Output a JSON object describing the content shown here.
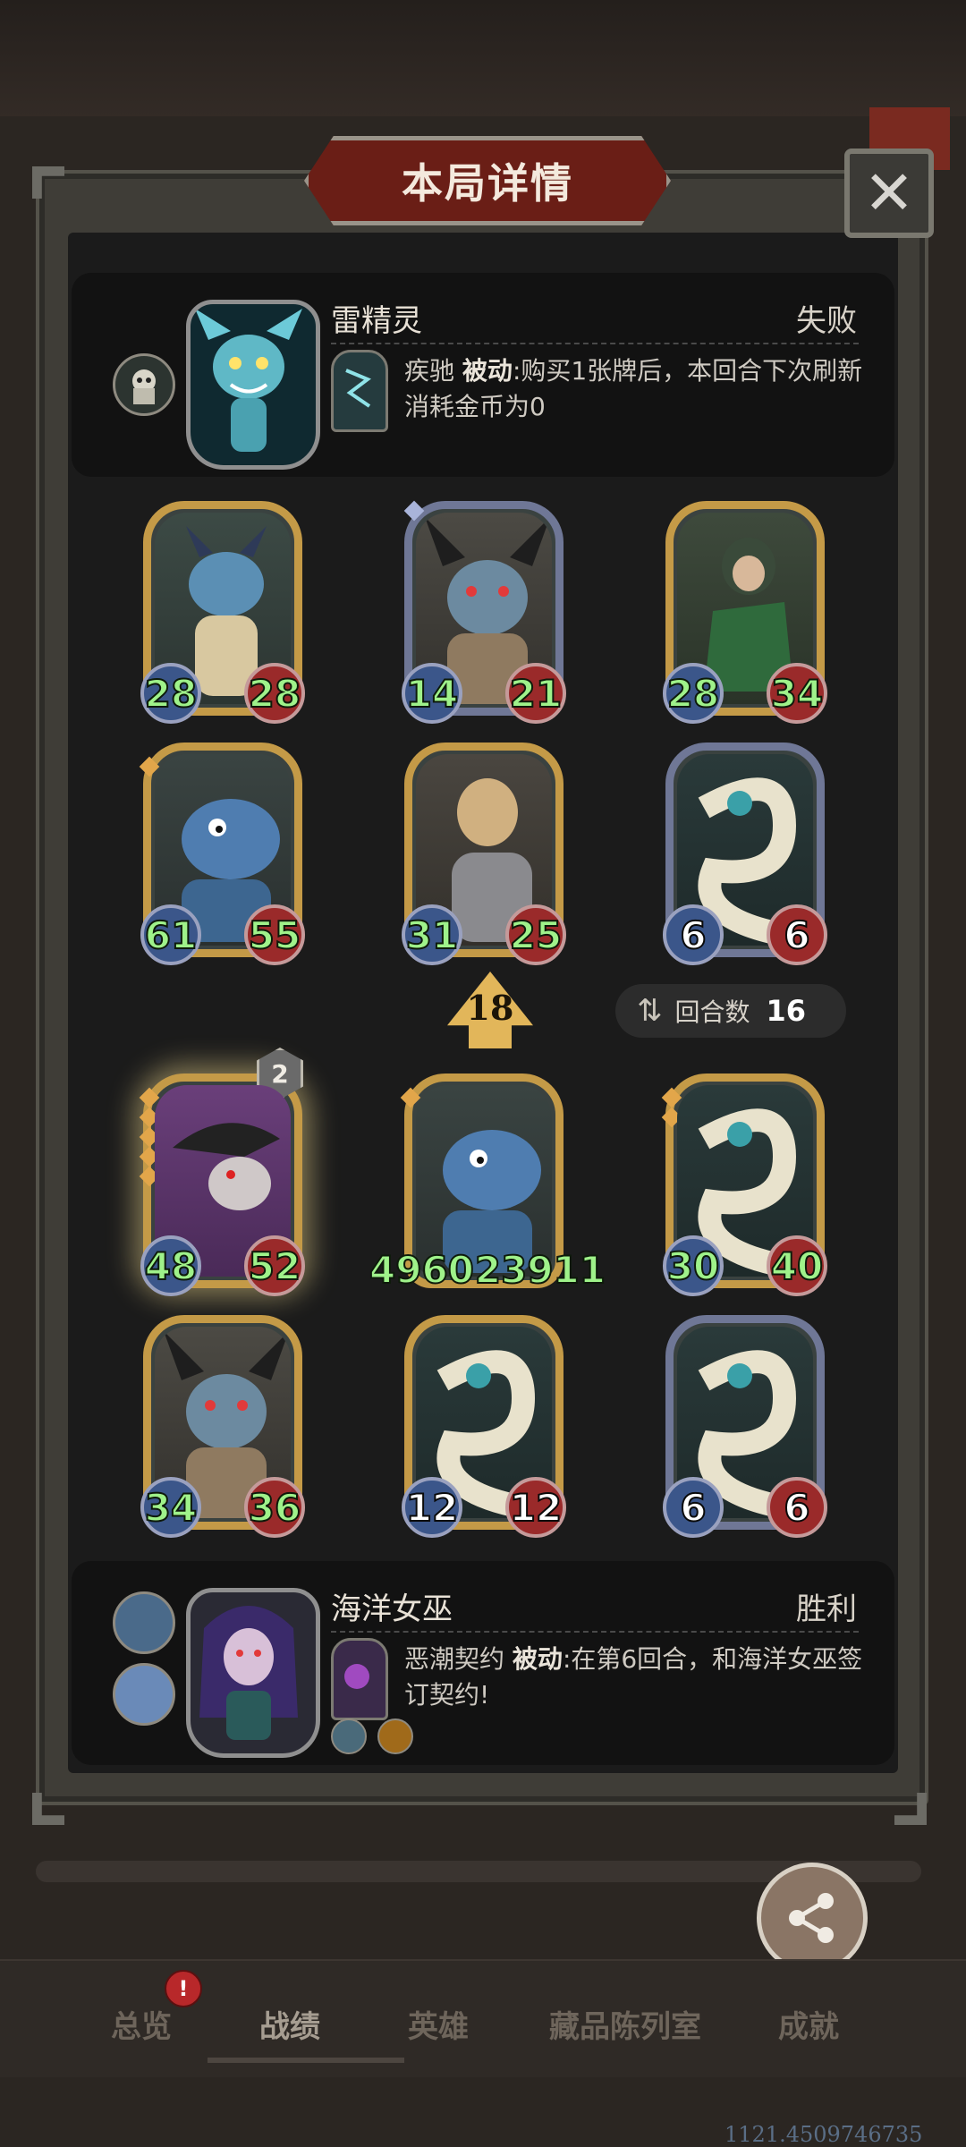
{
  "header": {
    "title": "本局详情",
    "close_symbol": "✕"
  },
  "top_player": {
    "name": "雷精灵",
    "result": "失败",
    "skill_name": "疾驰",
    "skill_type": "被动",
    "skill_desc": ":购买1张牌后，本回合下次刷新消耗金币为0"
  },
  "top_cards": [
    {
      "atk": "28",
      "hp": "28"
    },
    {
      "atk": "14",
      "hp": "21"
    },
    {
      "atk": "28",
      "hp": "34"
    },
    {
      "atk": "61",
      "hp": "55"
    },
    {
      "atk": "31",
      "hp": "25"
    },
    {
      "atk": "6",
      "hp": "6"
    }
  ],
  "middle": {
    "gold_value": "18",
    "round_label": "回合数",
    "round_value": "16"
  },
  "bottom_cards": [
    {
      "atk": "48",
      "hp": "52",
      "level": "2"
    },
    {
      "atk": "4960",
      "hp": "23911"
    },
    {
      "atk": "30",
      "hp": "40"
    },
    {
      "atk": "34",
      "hp": "36"
    },
    {
      "atk": "12",
      "hp": "12"
    },
    {
      "atk": "6",
      "hp": "6"
    }
  ],
  "bottom_player": {
    "name": "海洋女巫",
    "result": "胜利",
    "skill_name": "恶潮契约",
    "skill_type": "被动",
    "skill_desc": ":在第6回合，和海洋女巫签订契约!"
  },
  "share": {
    "label": "分享"
  },
  "nav": {
    "items": [
      "总览",
      "战绩",
      "英雄",
      "藏品陈列室",
      "成就"
    ],
    "badge": "!"
  },
  "watermark": "1121.4509746735"
}
